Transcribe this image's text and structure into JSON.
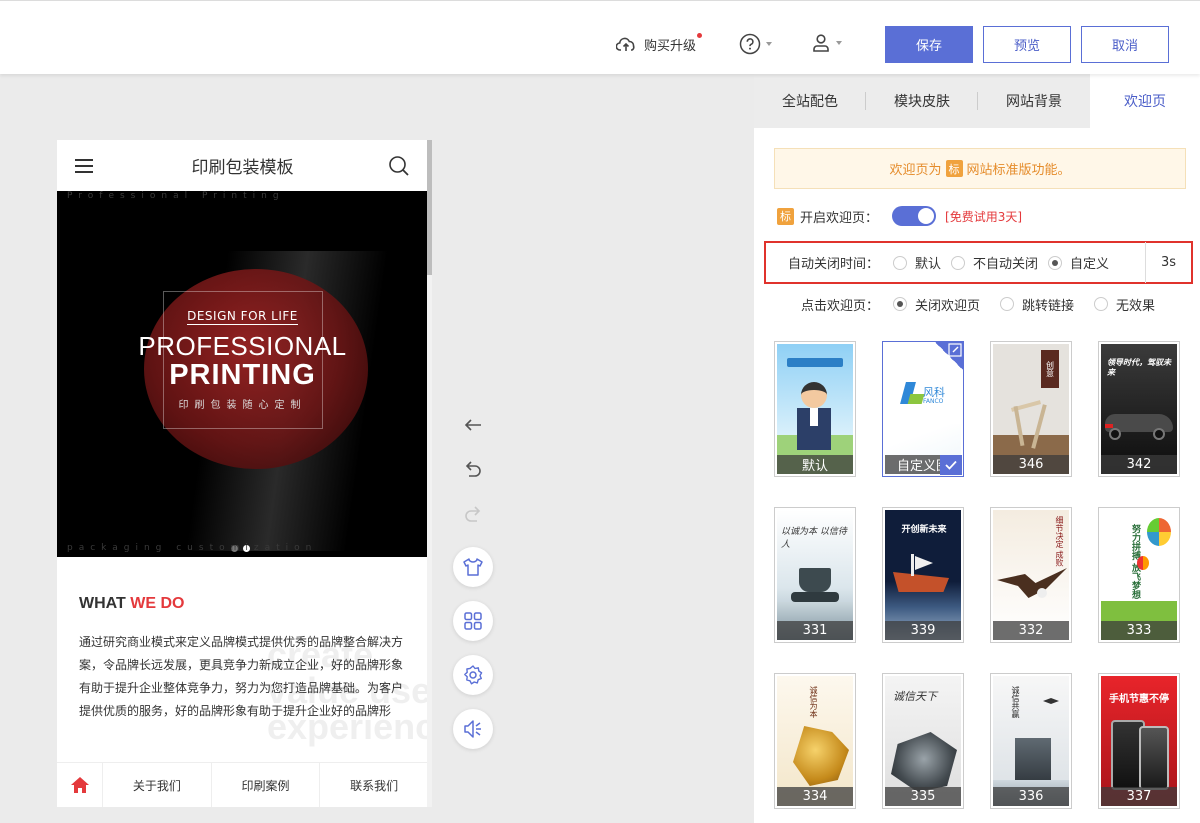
{
  "topbar": {
    "upgrade_label": "购买升级",
    "save_label": "保存",
    "preview_label": "预览",
    "cancel_label": "取消"
  },
  "phone": {
    "title": "印刷包装模板",
    "banner": {
      "strip_top": "Professional Printing",
      "strip_bottom": "packaging customization",
      "line1": "DESIGN FOR LIFE",
      "line2": "PROFESSIONAL",
      "line3": "PRINTING",
      "line4": "印刷包装随心定制"
    },
    "about": {
      "heading_a": "WHAT",
      "heading_b": "WE DO",
      "watermark": "create\nvalue user\nexperience",
      "body": "通过研究商业模式来定义品牌模式提供优秀的品牌整合解决方案，令品牌长远发展，更具竞争力新成立企业，好的品牌形象有助于提升企业整体竞争力，努力为您打造品牌基础。为客户提供优质的服务，好的品牌形象有助于提升企业好的品牌形"
    },
    "nav": [
      "关于我们",
      "印刷案例",
      "联系我们"
    ]
  },
  "panel": {
    "tabs": [
      "全站配色",
      "模块皮肤",
      "网站背景",
      "欢迎页"
    ],
    "active_tab": 3,
    "notice_a": "欢迎页为",
    "notice_badge": "标",
    "notice_b": "网站标准版功能。",
    "open_label": "开启欢迎页：",
    "trial": "[免费试用3天]",
    "close_label": "自动关闭时间：",
    "close_options": [
      "默认",
      "不自动关闭",
      "自定义"
    ],
    "close_selected": 2,
    "seconds": "3s",
    "click_label": "点击欢迎页：",
    "click_options": [
      "关闭欢迎页",
      "跳转链接",
      "无效果"
    ],
    "click_selected": 0
  },
  "templates": [
    {
      "caption": "默认",
      "theme": "cartoon"
    },
    {
      "caption": "自定义图",
      "theme": "custom",
      "logo": "风科",
      "logo_sub": "FANCO"
    },
    {
      "caption": "346",
      "theme": "chair",
      "text": "创意"
    },
    {
      "caption": "342",
      "theme": "car",
      "text": "领导时代，驾驭未来"
    },
    {
      "caption": "331",
      "theme": "tripod",
      "text": "以诚为本 以信待人"
    },
    {
      "caption": "339",
      "theme": "ship",
      "text": "开创新未来"
    },
    {
      "caption": "332",
      "theme": "eagle",
      "text": "细节决定 成败"
    },
    {
      "caption": "333",
      "theme": "balloon",
      "text": "努力拼搏 放飞梦想"
    },
    {
      "caption": "334",
      "theme": "dragon-gold",
      "text": "诚信为本"
    },
    {
      "caption": "335",
      "theme": "dragon-gray",
      "text": "诚信天下"
    },
    {
      "caption": "336",
      "theme": "monument",
      "text": "诚信共赢"
    },
    {
      "caption": "337",
      "theme": "phone",
      "text": "手机节惠不停"
    }
  ],
  "colors": {
    "accent": "#5a6fd6",
    "danger": "#e4393c",
    "notice": "#e58c2b"
  }
}
